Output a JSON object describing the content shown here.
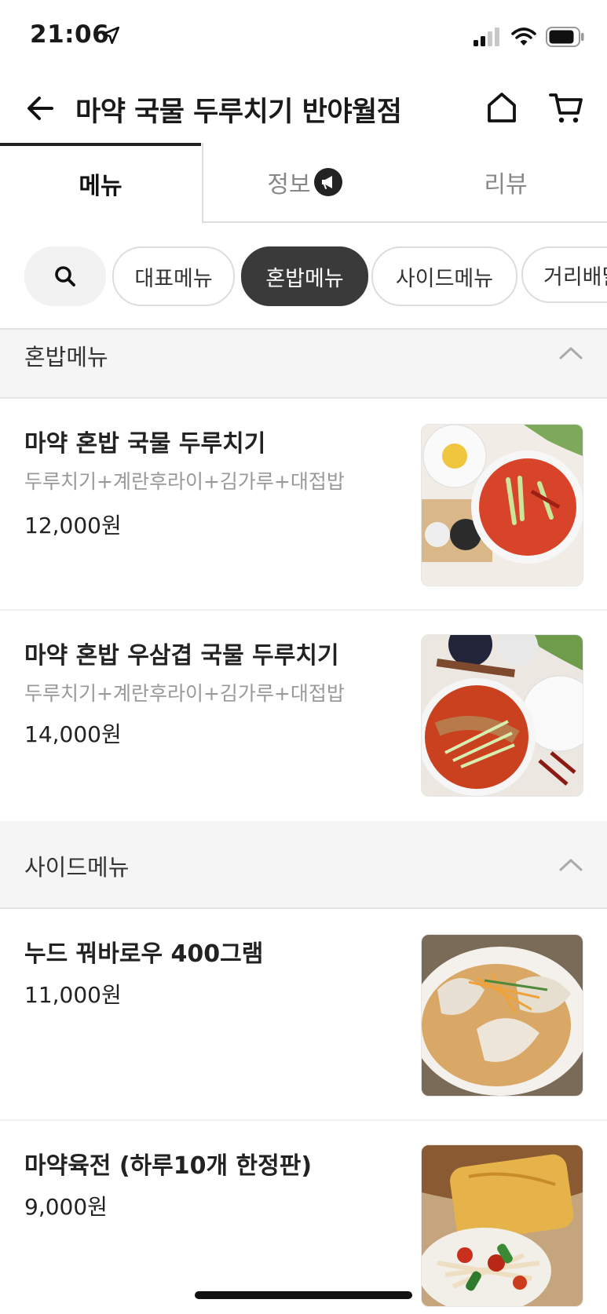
{
  "status_bar": {
    "time": "21:06"
  },
  "header": {
    "title": "마약 국물 두루치기 반야월점"
  },
  "tabs": [
    {
      "label": "메뉴"
    },
    {
      "label": "정보"
    },
    {
      "label": "리뷰"
    }
  ],
  "chips": [
    {
      "label": "대표메뉴"
    },
    {
      "label": "혼밥메뉴"
    },
    {
      "label": "사이드메뉴"
    },
    {
      "label": "거리배달"
    }
  ],
  "sections": [
    {
      "title": "혼밥메뉴",
      "items": [
        {
          "name": "마약 혼밥 국물 두루치기",
          "desc": "두루치기+계란후라이+김가루+대접밥",
          "price": "12,000원"
        },
        {
          "name": "마약  혼밥 우삼겹 국물 두루치기",
          "desc": "두루치기+계란후라이+김가루+대접밥",
          "price": "14,000원"
        }
      ]
    },
    {
      "title": "사이드메뉴",
      "items": [
        {
          "name": "누드 꿔바로우 400그램",
          "price": "11,000원"
        },
        {
          "name": "마약육전 (하루10개 한정판)",
          "price": "9,000원"
        }
      ]
    }
  ],
  "colors": {
    "active_chip": "#3a3a3a",
    "section_bg": "#f5f5f5",
    "muted_text": "#999999"
  }
}
